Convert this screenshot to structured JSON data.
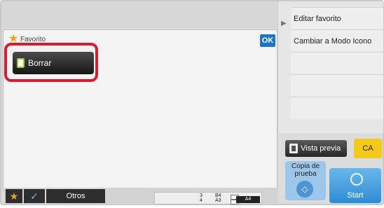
{
  "header": {
    "right_menu": [
      "Editar favorito",
      "Cambiar a Modo Icono"
    ]
  },
  "dialog": {
    "title": "Favorito",
    "ok_label": "OK",
    "delete_label": "Borrar"
  },
  "controls": {
    "preview_label": "Vista previa",
    "ca_label": "CA",
    "proof_label": "Copia de prueba",
    "start_label": "Start"
  },
  "bottom": {
    "other_label": "Otros",
    "trays": [
      {
        "number": "3",
        "size": "B4"
      },
      {
        "number": "4",
        "size": "A3"
      }
    ],
    "paper_size": "A4"
  },
  "colors": {
    "accent_blue": "#1f72c9",
    "highlight_red": "#d22032",
    "ca_yellow": "#f3c91a",
    "start_blue": "#2f8bd3"
  }
}
